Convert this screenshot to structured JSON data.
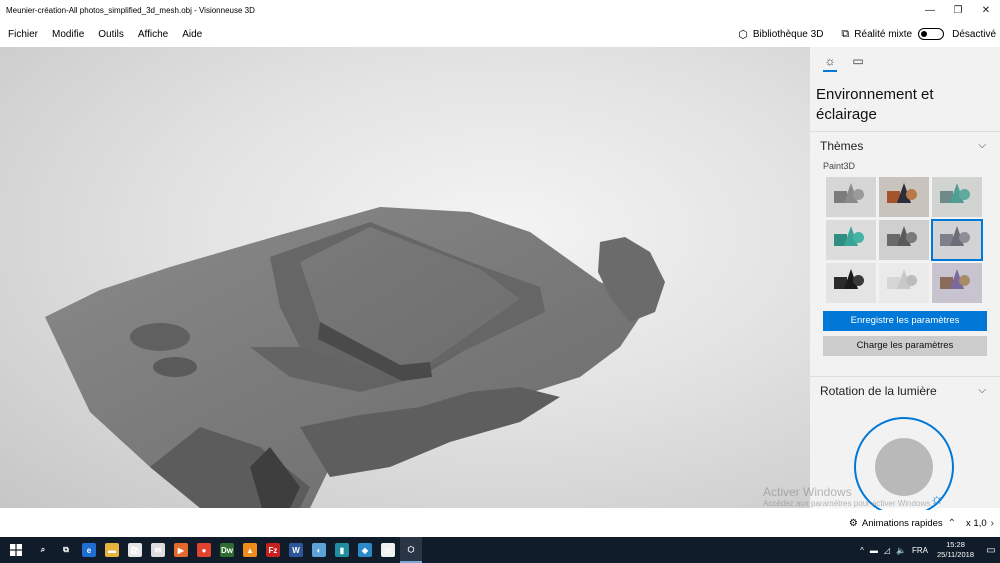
{
  "window": {
    "title": "Meunier-création-All photos_simplified_3d_mesh.obj - Visionneuse 3D",
    "minimize": "—",
    "restore": "❐",
    "close": "✕"
  },
  "menu": {
    "items": [
      "Fichier",
      "Modifie",
      "Outils",
      "Affiche",
      "Aide"
    ],
    "library_icon": "cube-outline-icon",
    "library_label": "Bibliothèque 3D",
    "mixed_reality_icon": "mixed-reality-icon",
    "mixed_reality_label": "Réalité mixte",
    "mixed_reality_state": "Désactivé"
  },
  "panel": {
    "tabs": [
      "sun-icon",
      "stats-icon"
    ],
    "tab_glyphs": [
      "☼",
      "▭"
    ],
    "title": "Environnement et éclairage",
    "themes_label": "Thèmes",
    "theme_group": "Paint3D",
    "themes": [
      {
        "bg": "#d6d6d6",
        "cone": "#8a8a8a",
        "cube": "#7c7c7c",
        "ball": "#9a9a9a"
      },
      {
        "bg": "#c9c3bd",
        "cone": "#2a2e3a",
        "cube": "#a4532b",
        "ball": "#b87a4a"
      },
      {
        "bg": "#d2d4d2",
        "cone": "#4f9e94",
        "cube": "#6e8a86",
        "ball": "#5fa99e"
      },
      {
        "bg": "#dcdcdc",
        "cone": "#3aa597",
        "cube": "#2f8e82",
        "ball": "#47b3a4"
      },
      {
        "bg": "#cfcfcf",
        "cone": "#5a5a5a",
        "cube": "#6a6a6a",
        "ball": "#7a7a7a"
      },
      {
        "bg": "#d3d3d6",
        "cone": "#6d6d78",
        "cube": "#80808a",
        "ball": "#8e8e98"
      },
      {
        "bg": "#e4e4e4",
        "cone": "#1a1a1a",
        "cube": "#2a2a2a",
        "ball": "#3a3a3a"
      },
      {
        "bg": "#eaeaea",
        "cone": "#c8c8c8",
        "cube": "#d6d6d6",
        "ball": "#bcbcbc"
      },
      {
        "bg": "#c7c3cf",
        "cone": "#7b6a9c",
        "cube": "#8a6a5a",
        "ball": "#a88c6a"
      }
    ],
    "selected_theme": 5,
    "save_label": "Enregistre les paramètres",
    "load_label": "Charge les paramètres",
    "rotation_label": "Rotation de la lumière"
  },
  "watermark": {
    "line1": "Activer Windows",
    "line2": "Accédez aux paramètres pour activer Windows."
  },
  "statusbar": {
    "animations_icon": "animation-icon",
    "animations_label": "Animations rapides",
    "zoom": "x 1,0"
  },
  "taskbar": {
    "apps": [
      {
        "name": "search-icon",
        "glyph": "⌕",
        "color": "transparent"
      },
      {
        "name": "task-view-icon",
        "glyph": "⧉",
        "color": "transparent"
      },
      {
        "name": "edge-icon",
        "glyph": "e",
        "color": "#1e6fd1"
      },
      {
        "name": "file-explorer-icon",
        "glyph": "▬",
        "color": "#e8b33c"
      },
      {
        "name": "store-icon",
        "glyph": "🛍",
        "color": "#e6e6e6"
      },
      {
        "name": "mail-icon",
        "glyph": "✉",
        "color": "#dddddd"
      },
      {
        "name": "media-player-icon",
        "glyph": "▶",
        "color": "#e36a2a"
      },
      {
        "name": "chrome-icon",
        "glyph": "●",
        "color": "#e0442e"
      },
      {
        "name": "dreamweaver-icon",
        "glyph": "Dw",
        "color": "#2f6b32"
      },
      {
        "name": "vlc-icon",
        "glyph": "▲",
        "color": "#f08d1a"
      },
      {
        "name": "filezilla-icon",
        "glyph": "Fz",
        "color": "#c8201e"
      },
      {
        "name": "word-icon",
        "glyph": "W",
        "color": "#2b579a"
      },
      {
        "name": "app-icon",
        "glyph": "◐",
        "color": "#5ea3d8"
      },
      {
        "name": "book-icon",
        "glyph": "▮",
        "color": "#1f8fa0"
      },
      {
        "name": "layers-icon",
        "glyph": "◆",
        "color": "#2a8ac8"
      },
      {
        "name": "paint-icon",
        "glyph": "▱",
        "color": "#f0f0f0"
      },
      {
        "name": "3d-viewer-icon",
        "glyph": "⬡",
        "color": "transparent"
      }
    ],
    "tray_icons": [
      "^",
      "▬",
      "◿",
      "🔈"
    ],
    "language": "FRA",
    "time": "15:28",
    "date": "25/11/2018"
  }
}
